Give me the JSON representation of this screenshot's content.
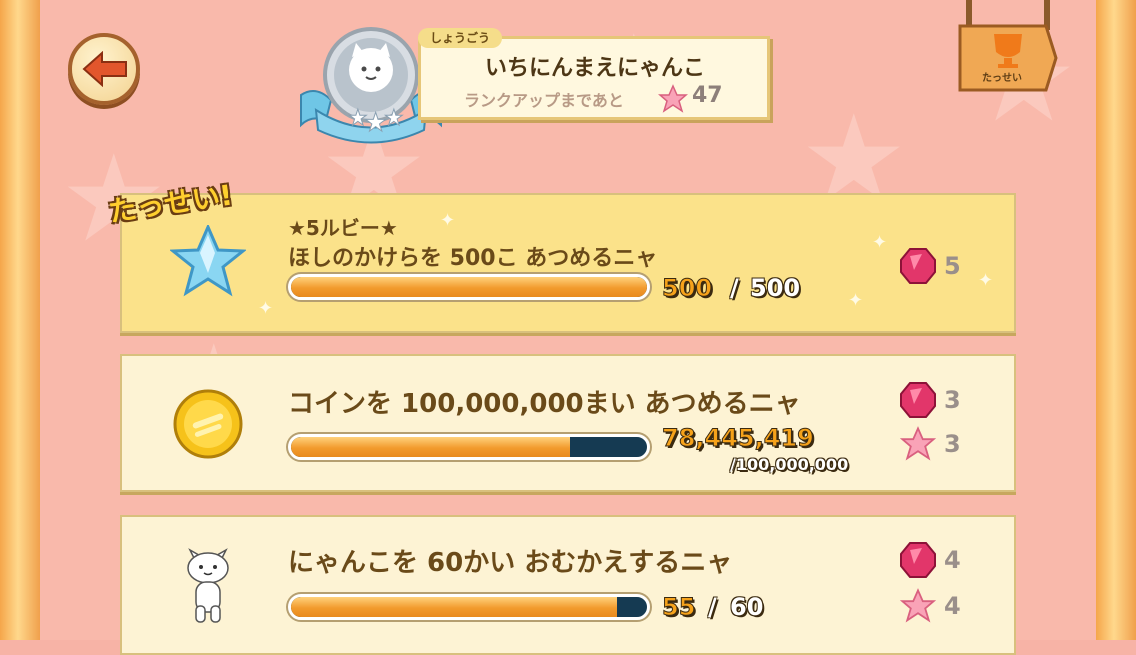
{
  "header": {
    "title_tag": "しょうごう",
    "title_name": "いちにんまえにゃんこ",
    "rank_up_label": "ランクアップまであと",
    "rank_up_value": "47",
    "achievements_button_label": "たっせい"
  },
  "achievements": [
    {
      "completed_label": "たっせい!",
      "title_line1": "★5ルビー★",
      "title_line2": "ほしのかけらを 500こ あつめるニャ",
      "current": "500",
      "separator": "/",
      "max": "500",
      "progress": 1.0,
      "rewards": [
        {
          "type": "ruby",
          "amount": "5"
        }
      ]
    },
    {
      "title_line1": "コインを 100,000,000まい あつめるニャ",
      "current": "78,445,419",
      "max": "/100,000,000",
      "progress": 0.784,
      "rewards": [
        {
          "type": "ruby",
          "amount": "3"
        },
        {
          "type": "star",
          "amount": "3"
        }
      ]
    },
    {
      "title_line1": "にゃんこを 60かい おむかえするニャ",
      "current": "55",
      "separator": "/",
      "max": "60",
      "progress": 0.917,
      "rewards": [
        {
          "type": "ruby",
          "amount": "4"
        },
        {
          "type": "star",
          "amount": "4"
        }
      ]
    }
  ],
  "colors": {
    "background": "#f9b9ab",
    "card_completed": "#fbe28a",
    "card_normal": "#fdf3d4",
    "progress_fill": "#f29b2d",
    "progress_track": "#153a52"
  }
}
